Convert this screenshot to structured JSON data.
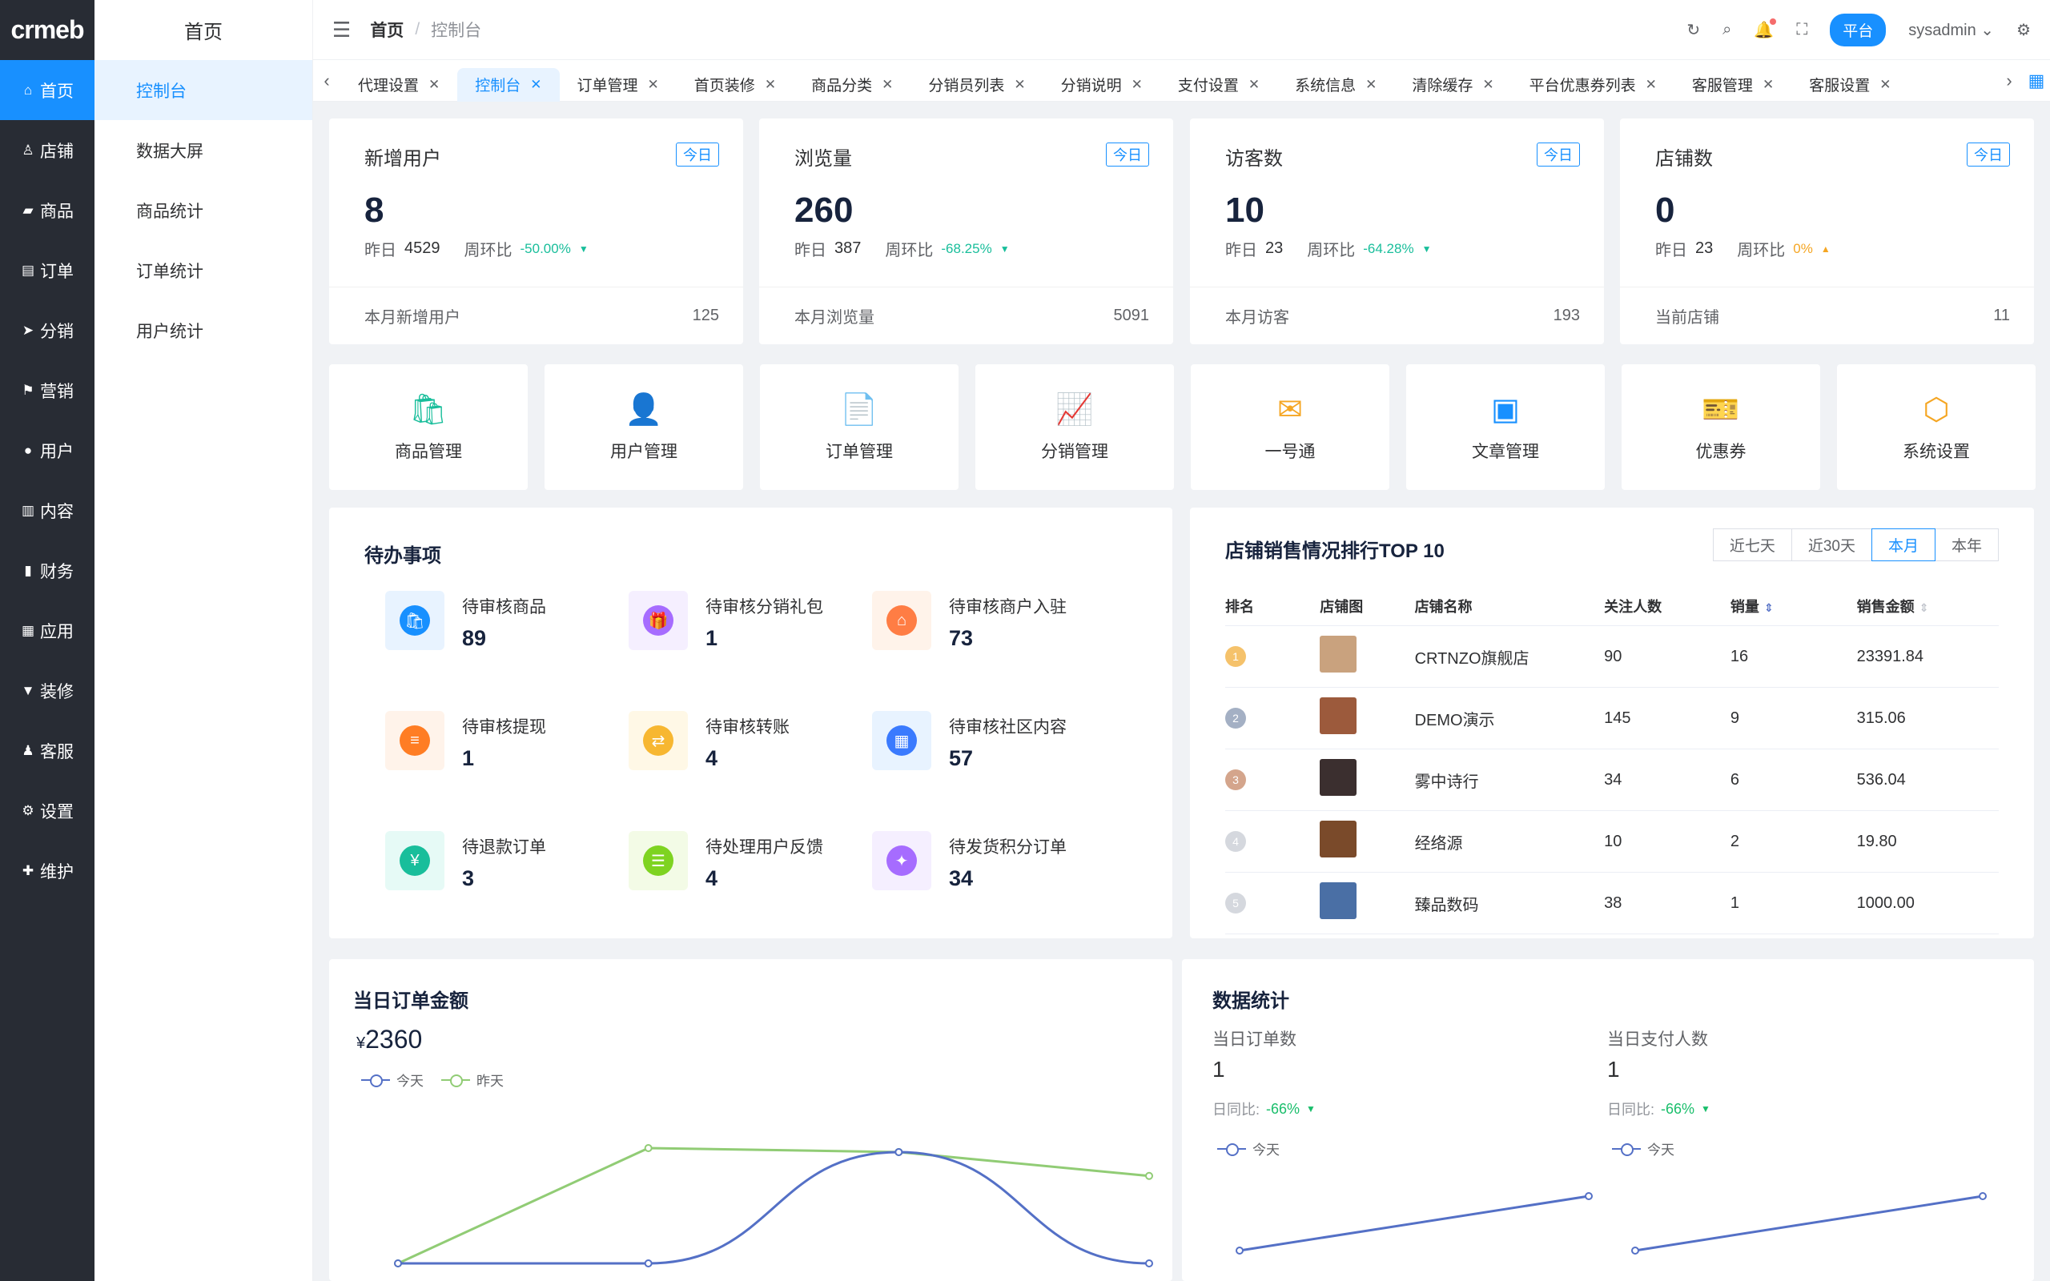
{
  "logo": "crmeb",
  "left_nav": [
    {
      "label": "首页",
      "icon": "home-icon",
      "glyph": "⌂"
    },
    {
      "label": "店铺",
      "icon": "store-icon",
      "glyph": "♙"
    },
    {
      "label": "商品",
      "icon": "bag-icon",
      "glyph": "▰"
    },
    {
      "label": "订单",
      "icon": "order-icon",
      "glyph": "▤"
    },
    {
      "label": "分销",
      "icon": "share-icon",
      "glyph": "➤"
    },
    {
      "label": "营销",
      "icon": "flag-icon",
      "glyph": "⚑"
    },
    {
      "label": "用户",
      "icon": "user-icon",
      "glyph": "●"
    },
    {
      "label": "内容",
      "icon": "content-icon",
      "glyph": "▥"
    },
    {
      "label": "财务",
      "icon": "finance-icon",
      "glyph": "▮"
    },
    {
      "label": "应用",
      "icon": "apps-icon",
      "glyph": "▦"
    },
    {
      "label": "装修",
      "icon": "decorate-icon",
      "glyph": "▼"
    },
    {
      "label": "客服",
      "icon": "service-icon",
      "glyph": "♟"
    },
    {
      "label": "设置",
      "icon": "gear-icon",
      "glyph": "⚙"
    },
    {
      "label": "维护",
      "icon": "maintain-icon",
      "glyph": "✚"
    }
  ],
  "sub_nav": {
    "title": "首页",
    "items": [
      "控制台",
      "数据大屏",
      "商品统计",
      "订单统计",
      "用户统计"
    ]
  },
  "topbar": {
    "crumb_home": "首页",
    "crumb_sep": "/",
    "crumb_current": "控制台",
    "platform": "平台",
    "user": "sysadmin"
  },
  "tabs": [
    "代理设置",
    "控制台",
    "订单管理",
    "首页装修",
    "商品分类",
    "分销员列表",
    "分销说明",
    "支付设置",
    "系统信息",
    "清除缓存",
    "平台优惠券列表",
    "客服管理",
    "客服设置"
  ],
  "stats": [
    {
      "title": "新增用户",
      "badge": "今日",
      "value": "8",
      "yesterday_label": "昨日",
      "yesterday": "4529",
      "ratio_label": "周环比",
      "ratio": "-50.00%",
      "trend": "▼",
      "foot_label": "本月新增用户",
      "foot_value": "125"
    },
    {
      "title": "浏览量",
      "badge": "今日",
      "value": "260",
      "yesterday_label": "昨日",
      "yesterday": "387",
      "ratio_label": "周环比",
      "ratio": "-68.25%",
      "trend": "▼",
      "foot_label": "本月浏览量",
      "foot_value": "5091"
    },
    {
      "title": "访客数",
      "badge": "今日",
      "value": "10",
      "yesterday_label": "昨日",
      "yesterday": "23",
      "ratio_label": "周环比",
      "ratio": "-64.28%",
      "trend": "▼",
      "foot_label": "本月访客",
      "foot_value": "193"
    },
    {
      "title": "店铺数",
      "badge": "今日",
      "value": "0",
      "yesterday_label": "昨日",
      "yesterday": "23",
      "ratio_label": "周环比",
      "ratio": "0%",
      "trend": "▲",
      "foot_label": "当前店铺",
      "foot_value": "11"
    }
  ],
  "quick": [
    {
      "label": "商品管理",
      "icon": "shopping-bag-icon",
      "glyph": "🛍",
      "color": "#19be9b"
    },
    {
      "label": "用户管理",
      "icon": "user-icon",
      "glyph": "👤",
      "color": "#1890ff"
    },
    {
      "label": "订单管理",
      "icon": "document-icon",
      "glyph": "📄",
      "color": "#ff7d44"
    },
    {
      "label": "分销管理",
      "icon": "chart-icon",
      "glyph": "📈",
      "color": "#a66cff"
    },
    {
      "label": "一号通",
      "icon": "mail-icon",
      "glyph": "✉",
      "color": "#f5a623"
    },
    {
      "label": "文章管理",
      "icon": "article-icon",
      "glyph": "▣",
      "color": "#1890ff"
    },
    {
      "label": "优惠券",
      "icon": "coupon-icon",
      "glyph": "🎫",
      "color": "#ff5a5a"
    },
    {
      "label": "系统设置",
      "icon": "hexagon-icon",
      "glyph": "⬡",
      "color": "#f5a623"
    }
  ],
  "todo": {
    "title": "待办事项",
    "items": [
      {
        "label": "待审核商品",
        "count": "89",
        "icon": "bag-icon",
        "glyph": "🛍",
        "bg": "#e8f3ff",
        "fg": "#1890ff"
      },
      {
        "label": "待审核分销礼包",
        "count": "1",
        "icon": "gift-icon",
        "glyph": "🎁",
        "bg": "#f5efff",
        "fg": "#a66cff"
      },
      {
        "label": "待审核商户入驻",
        "count": "73",
        "icon": "shop-icon",
        "glyph": "⌂",
        "bg": "#fff3ea",
        "fg": "#ff7d44"
      },
      {
        "label": "待审核提现",
        "count": "1",
        "icon": "withdraw-icon",
        "glyph": "≡",
        "bg": "#fff3ea",
        "fg": "#ff7d24"
      },
      {
        "label": "待审核转账",
        "count": "4",
        "icon": "transfer-icon",
        "glyph": "⇄",
        "bg": "#fff8e6",
        "fg": "#f7b731"
      },
      {
        "label": "待审核社区内容",
        "count": "57",
        "icon": "calendar-icon",
        "glyph": "▦",
        "bg": "#e8f3ff",
        "fg": "#3a7afe"
      },
      {
        "label": "待退款订单",
        "count": "3",
        "icon": "refund-icon",
        "glyph": "¥",
        "bg": "#e6faf6",
        "fg": "#19be9b"
      },
      {
        "label": "待处理用户反馈",
        "count": "4",
        "icon": "feedback-icon",
        "glyph": "☰",
        "bg": "#f3fbe6",
        "fg": "#7ed321"
      },
      {
        "label": "待发货积分订单",
        "count": "34",
        "icon": "points-icon",
        "glyph": "✦",
        "bg": "#f5efff",
        "fg": "#a66cff"
      }
    ]
  },
  "ranking": {
    "title": "店铺销售情况排行TOP 10",
    "ranges": [
      "近七天",
      "近30天",
      "本月",
      "本年"
    ],
    "active_range": "本月",
    "headers": [
      "排名",
      "店铺图",
      "店铺名称",
      "关注人数",
      "销量",
      "销售金额"
    ],
    "rows": [
      {
        "rank": "1",
        "name": "CRTNZO旗舰店",
        "followers": "90",
        "sales": "16",
        "amount": "23391.84",
        "rank_color": "#f5c26b",
        "thumb": "#c9a27e"
      },
      {
        "rank": "2",
        "name": "DEMO演示",
        "followers": "145",
        "sales": "9",
        "amount": "315.06",
        "rank_color": "#a4b0c4",
        "thumb": "#9c5a3c"
      },
      {
        "rank": "3",
        "name": "雾中诗行",
        "followers": "34",
        "sales": "6",
        "amount": "536.04",
        "rank_color": "#d4a58c",
        "thumb": "#3b2f2f"
      },
      {
        "rank": "4",
        "name": "经络源",
        "followers": "10",
        "sales": "2",
        "amount": "19.80",
        "rank_color": "#d5d8de",
        "thumb": "#7a4a2a"
      },
      {
        "rank": "5",
        "name": "臻品数码",
        "followers": "38",
        "sales": "1",
        "amount": "1000.00",
        "rank_color": "#d5d8de",
        "thumb": "#4a6fa5"
      }
    ]
  },
  "order_amount": {
    "title": "当日订单金额",
    "currency": "¥",
    "value": "2360",
    "legend_today": "今天",
    "legend_yesterday": "昨天",
    "colors": {
      "today": "#5470c6",
      "yesterday": "#91cc75"
    }
  },
  "data_stats": {
    "title": "数据统计",
    "orders_label": "当日订单数",
    "orders_value": "1",
    "orders_ratio_label": "日同比:",
    "orders_ratio": "-66%",
    "payers_label": "当日支付人数",
    "payers_value": "1",
    "payers_ratio_label": "日同比:",
    "payers_ratio": "-66%",
    "legend_today": "今天"
  },
  "chart_data": [
    {
      "type": "line",
      "series": [
        {
          "name": "今天",
          "values": [
            0,
            0,
            1.4,
            0
          ]
        },
        {
          "name": "昨天",
          "values": [
            0,
            1.45,
            1.4,
            1.1
          ]
        }
      ]
    },
    {
      "type": "line",
      "series": [
        {
          "name": "今天",
          "values": [
            0,
            1
          ]
        }
      ]
    },
    {
      "type": "line",
      "series": [
        {
          "name": "今天",
          "values": [
            0,
            1
          ]
        }
      ]
    }
  ]
}
